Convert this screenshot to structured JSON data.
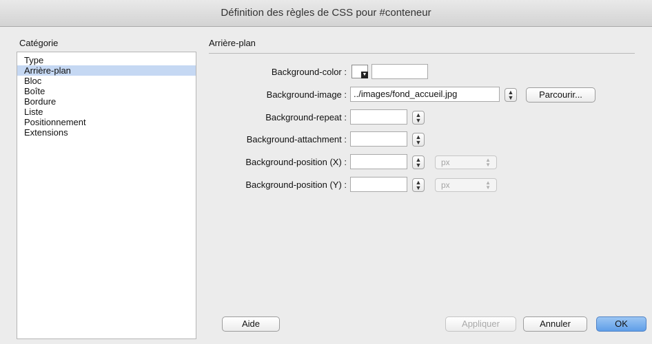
{
  "window": {
    "title": "Définition des règles de CSS pour #conteneur"
  },
  "sidebar": {
    "heading": "Catégorie",
    "items": [
      {
        "label": "Type",
        "selected": false
      },
      {
        "label": "Arrière-plan",
        "selected": true
      },
      {
        "label": "Bloc",
        "selected": false
      },
      {
        "label": "Boîte",
        "selected": false
      },
      {
        "label": "Bordure",
        "selected": false
      },
      {
        "label": "Liste",
        "selected": false
      },
      {
        "label": "Positionnement",
        "selected": false
      },
      {
        "label": "Extensions",
        "selected": false
      }
    ]
  },
  "panel": {
    "heading": "Arrière-plan",
    "bg_color": {
      "label": "Background-color :",
      "value": ""
    },
    "bg_image": {
      "label": "Background-image :",
      "value": "../images/fond_accueil.jpg",
      "browse_label": "Parcourir..."
    },
    "bg_repeat": {
      "label": "Background-repeat :",
      "value": ""
    },
    "bg_attachment": {
      "label": "Background-attachment :",
      "value": ""
    },
    "bg_position_x": {
      "label": "Background-position (X) :",
      "value": "",
      "unit": "px"
    },
    "bg_position_y": {
      "label": "Background-position (Y) :",
      "value": "",
      "unit": "px"
    }
  },
  "footer": {
    "help_label": "Aide",
    "apply_label": "Appliquer",
    "cancel_label": "Annuler",
    "ok_label": "OK"
  },
  "colors": {
    "selection": "#c5d8f3",
    "default_button": "#6aa6ec"
  }
}
